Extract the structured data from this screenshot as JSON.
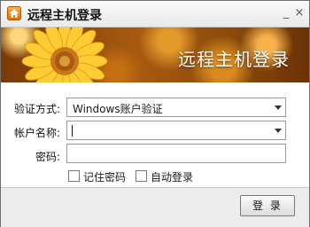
{
  "window": {
    "title": "远程主机登录",
    "icon": "home-icon",
    "minimize_glyph": "_",
    "close_glyph": "×"
  },
  "banner": {
    "title": "远程主机登录"
  },
  "form": {
    "auth_label": "验证方式:",
    "auth_value": "Windows账户验证",
    "username_label": "帐户名称:",
    "username_value": "",
    "password_label": "密码:",
    "password_value": "",
    "remember_password_label": "记住密码",
    "remember_password_checked": false,
    "auto_login_label": "自动登录",
    "auto_login_checked": false
  },
  "footer": {
    "login_label": "登 录"
  },
  "colors": {
    "banner_base": "#a85a10",
    "banner_text": "#ffffff",
    "footer_bg": "#ececec"
  }
}
